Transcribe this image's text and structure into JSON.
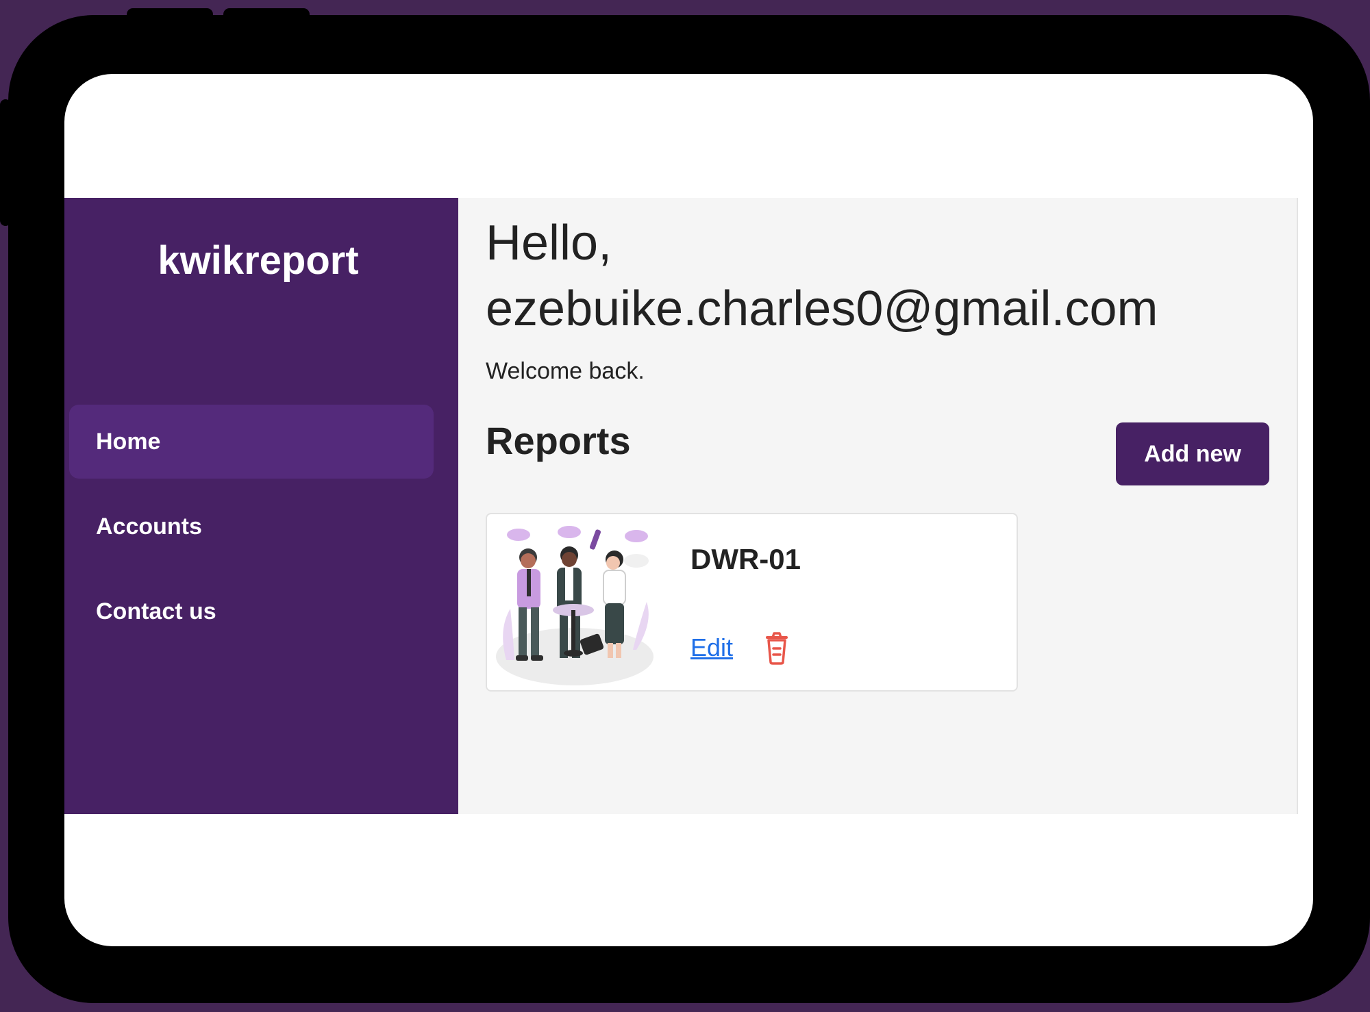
{
  "app": {
    "brand": "kwikreport"
  },
  "sidebar": {
    "items": [
      {
        "label": "Home",
        "active": true
      },
      {
        "label": "Accounts",
        "active": false
      },
      {
        "label": "Contact us",
        "active": false
      }
    ]
  },
  "main": {
    "greeting": "Hello, ezebuike.charles0@gmail.com",
    "welcome": "Welcome back.",
    "section_title": "Reports",
    "add_button": "Add new"
  },
  "reports": [
    {
      "title": "DWR-01",
      "edit_label": "Edit",
      "image_icon": "people-celebrating-illustration",
      "delete_icon": "trash-icon"
    }
  ],
  "colors": {
    "brand_purple": "#472164",
    "active_nav": "#542a7b",
    "link_blue": "#1f6fe8",
    "delete_red": "#e8564a"
  }
}
